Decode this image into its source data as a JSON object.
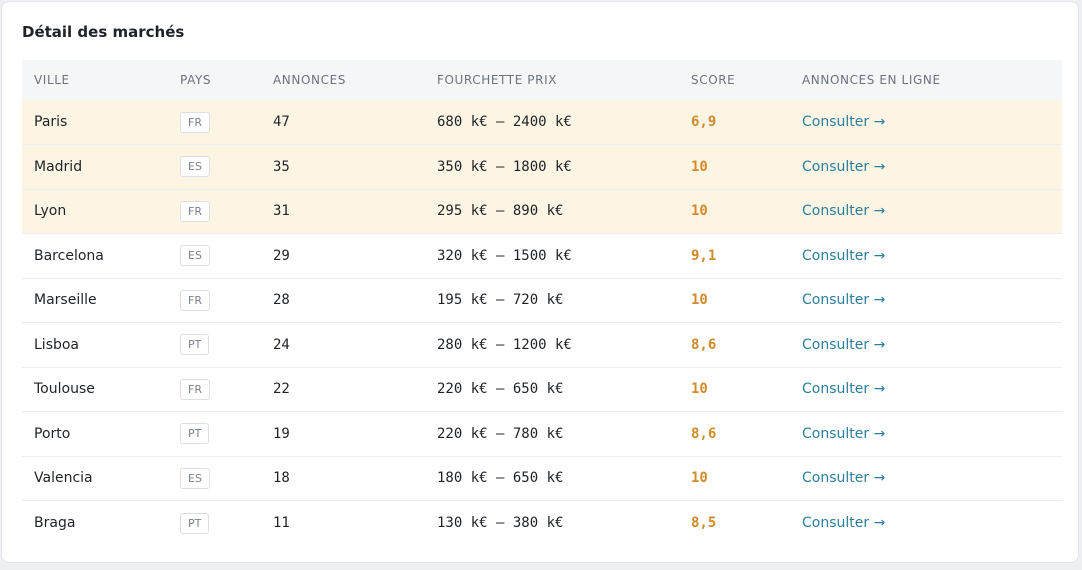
{
  "colors": {
    "score": "#d38a2a",
    "link": "#2b7f9e",
    "highlight_row": "#fdf5e4"
  },
  "section": {
    "title": "Détail des marchés"
  },
  "table": {
    "columns": [
      "VILLE",
      "PAYS",
      "ANNONCES",
      "FOURCHETTE PRIX",
      "SCORE",
      "ANNONCES EN LIGNE"
    ],
    "rows": [
      {
        "city": "Paris",
        "country": "FR",
        "count": "47",
        "price": "680 k€ – 2400 k€",
        "score": "6,9",
        "link": "Consulter →",
        "highlighted": true
      },
      {
        "city": "Madrid",
        "country": "ES",
        "count": "35",
        "price": "350 k€ – 1800 k€",
        "score": "10",
        "link": "Consulter →",
        "highlighted": true
      },
      {
        "city": "Lyon",
        "country": "FR",
        "count": "31",
        "price": "295 k€ – 890 k€",
        "score": "10",
        "link": "Consulter →",
        "highlighted": true
      },
      {
        "city": "Barcelona",
        "country": "ES",
        "count": "29",
        "price": "320 k€ – 1500 k€",
        "score": "9,1",
        "link": "Consulter →",
        "highlighted": false
      },
      {
        "city": "Marseille",
        "country": "FR",
        "count": "28",
        "price": "195 k€ – 720 k€",
        "score": "10",
        "link": "Consulter →",
        "highlighted": false
      },
      {
        "city": "Lisboa",
        "country": "PT",
        "count": "24",
        "price": "280 k€ – 1200 k€",
        "score": "8,6",
        "link": "Consulter →",
        "highlighted": false
      },
      {
        "city": "Toulouse",
        "country": "FR",
        "count": "22",
        "price": "220 k€ – 650 k€",
        "score": "10",
        "link": "Consulter →",
        "highlighted": false
      },
      {
        "city": "Porto",
        "country": "PT",
        "count": "19",
        "price": "220 k€ – 780 k€",
        "score": "8,6",
        "link": "Consulter →",
        "highlighted": false
      },
      {
        "city": "Valencia",
        "country": "ES",
        "count": "18",
        "price": "180 k€ – 650 k€",
        "score": "10",
        "link": "Consulter →",
        "highlighted": false
      },
      {
        "city": "Braga",
        "country": "PT",
        "count": "11",
        "price": "130 k€ – 380 k€",
        "score": "8,5",
        "link": "Consulter →",
        "highlighted": false
      }
    ]
  }
}
